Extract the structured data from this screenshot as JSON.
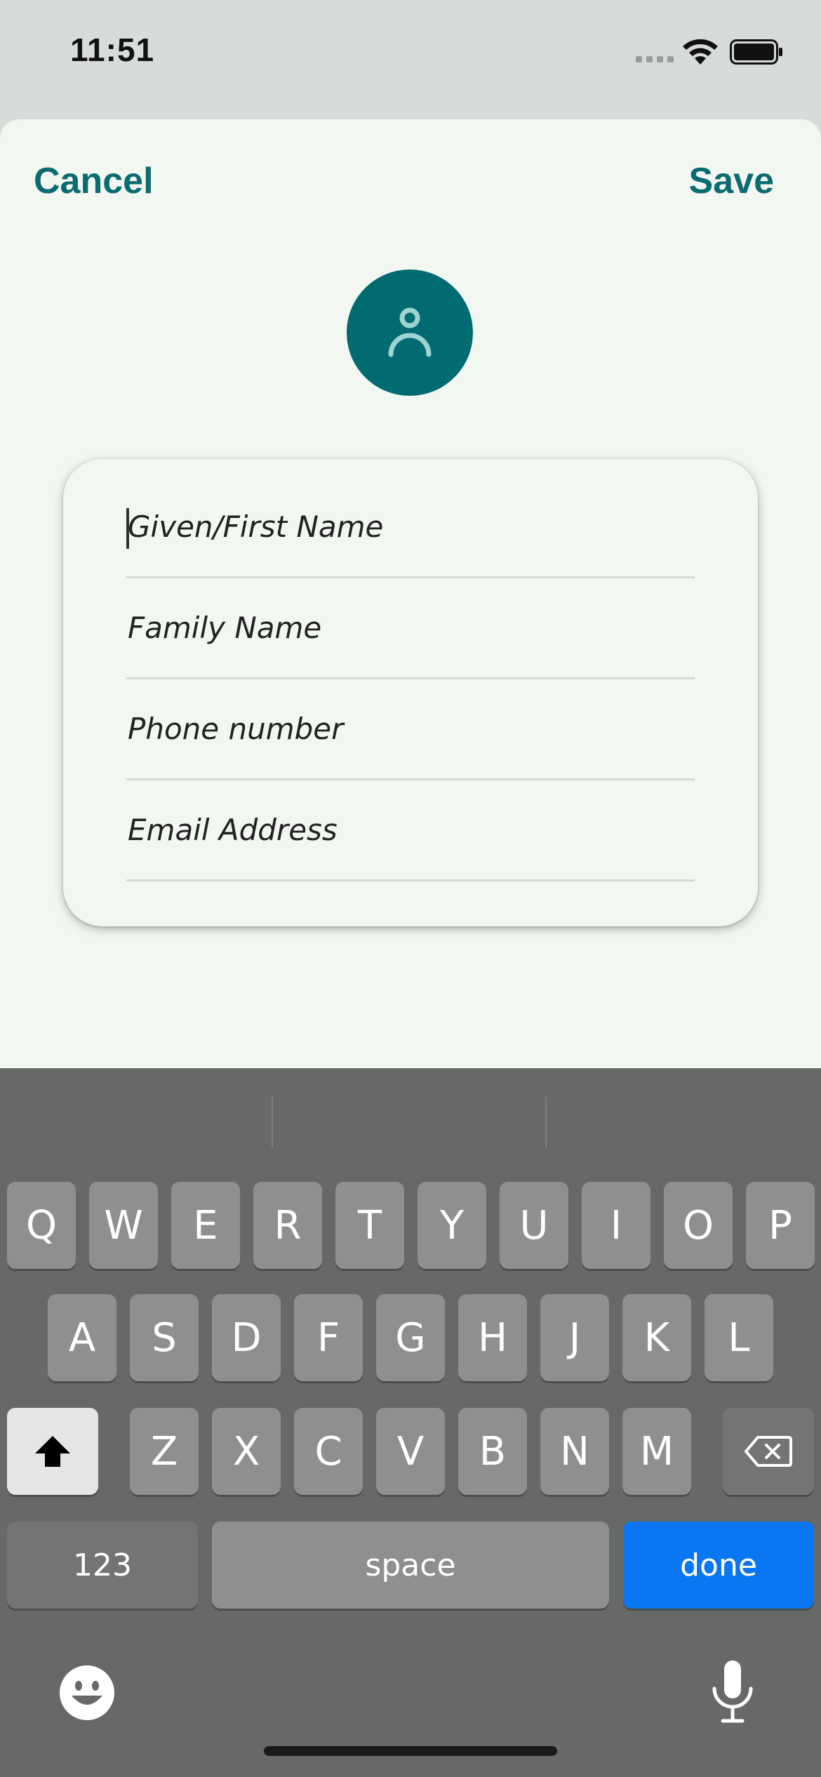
{
  "status_bar": {
    "time": "11:51",
    "icons": [
      "signal-icon",
      "wifi-icon",
      "battery-icon"
    ]
  },
  "header": {
    "cancel_label": "Cancel",
    "save_label": "Save",
    "accent_color": "#0a6b70"
  },
  "avatar": {
    "icon": "person-icon",
    "background": "#006b70"
  },
  "form": {
    "fields": [
      {
        "placeholder": "Given/First Name",
        "value": "",
        "focused": true
      },
      {
        "placeholder": "Family Name",
        "value": ""
      },
      {
        "placeholder": "Phone number",
        "value": ""
      },
      {
        "placeholder": "Email Address",
        "value": ""
      }
    ]
  },
  "keyboard": {
    "row1": [
      "Q",
      "W",
      "E",
      "R",
      "T",
      "Y",
      "U",
      "I",
      "O",
      "P"
    ],
    "row2": [
      "A",
      "S",
      "D",
      "F",
      "G",
      "H",
      "J",
      "K",
      "L"
    ],
    "row3": [
      "Z",
      "X",
      "C",
      "V",
      "B",
      "N",
      "M"
    ],
    "numbers_label": "123",
    "space_label": "space",
    "done_label": "done",
    "shift_icon": "shift-icon",
    "delete_icon": "delete-icon",
    "emoji_icon": "emoji-icon",
    "mic_icon": "microphone-icon",
    "done_color": "#0a76f2"
  }
}
